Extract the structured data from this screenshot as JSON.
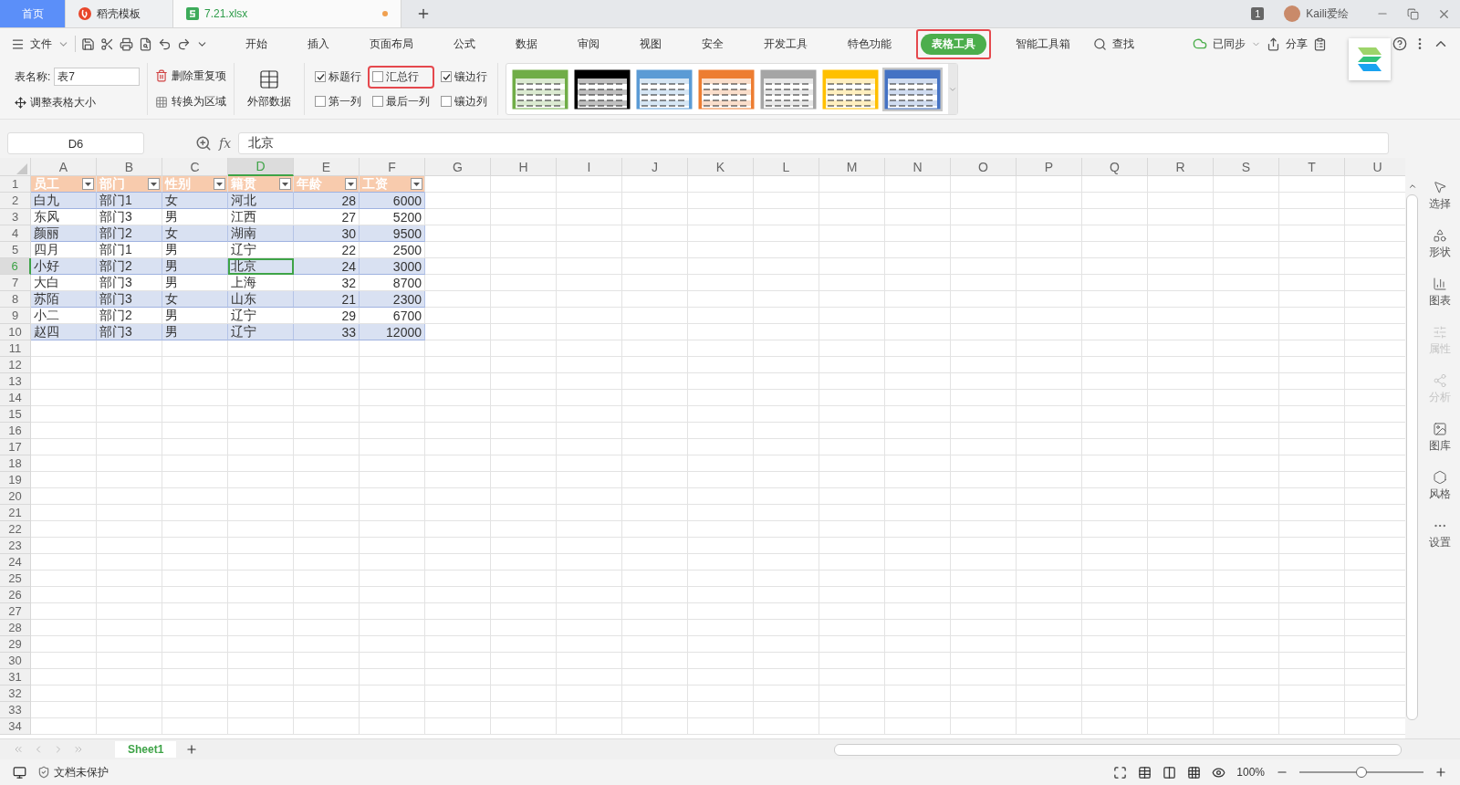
{
  "tabs": [
    {
      "kind": "home",
      "label": "首页",
      "selected": false
    },
    {
      "kind": "docer",
      "label": "稻壳模板",
      "selected": false
    },
    {
      "kind": "sheet",
      "label": "7.21.xlsx",
      "selected": true,
      "unsaved": true
    }
  ],
  "title_bar": {
    "window_count": "1",
    "user": "Kaili爱绘"
  },
  "menu": {
    "file": "文件",
    "tabs": [
      {
        "label": "开始",
        "selected": false,
        "highlighted": false
      },
      {
        "label": "插入",
        "selected": false,
        "highlighted": false
      },
      {
        "label": "页面布局",
        "selected": false,
        "highlighted": false
      },
      {
        "label": "公式",
        "selected": false,
        "highlighted": false
      },
      {
        "label": "数据",
        "selected": false,
        "highlighted": false
      },
      {
        "label": "审阅",
        "selected": false,
        "highlighted": false
      },
      {
        "label": "视图",
        "selected": false,
        "highlighted": false
      },
      {
        "label": "安全",
        "selected": false,
        "highlighted": false
      },
      {
        "label": "开发工具",
        "selected": false,
        "highlighted": false
      },
      {
        "label": "特色功能",
        "selected": false,
        "highlighted": false
      },
      {
        "label": "表格工具",
        "selected": true,
        "highlighted": true
      },
      {
        "label": "智能工具箱",
        "selected": false,
        "highlighted": false
      }
    ],
    "search": "查找",
    "sync": "已同步",
    "share": "分享"
  },
  "ribbon": {
    "table_name_label": "表名称:",
    "table_name": "表7",
    "resize": "调整表格大小",
    "remove_duplicates": "删除重复项",
    "convert_to_range": "转换为区域",
    "external_data": "外部数据",
    "options": [
      {
        "kind": "header_row",
        "label": "标题行",
        "checked": true,
        "highlighted": false
      },
      {
        "kind": "total_row",
        "label": "汇总行",
        "checked": false,
        "highlighted": true
      },
      {
        "kind": "banded_rows",
        "label": "镶边行",
        "checked": true,
        "highlighted": false
      },
      {
        "kind": "first_column",
        "label": "第一列",
        "checked": false,
        "highlighted": false
      },
      {
        "kind": "last_column",
        "label": "最后一列",
        "checked": false,
        "highlighted": false
      },
      {
        "kind": "banded_columns",
        "label": "镶边列",
        "checked": false,
        "highlighted": false
      }
    ],
    "styles": [
      {
        "color": "#70ad47",
        "selected": false
      },
      {
        "color": "#000000",
        "selected": false
      },
      {
        "color": "#5b9bd5",
        "selected": false
      },
      {
        "color": "#ed7d31",
        "selected": false
      },
      {
        "color": "#a5a5a5",
        "selected": false
      },
      {
        "color": "#ffc000",
        "selected": false
      },
      {
        "color": "#4472c4",
        "selected": true
      }
    ]
  },
  "formula_bar": {
    "cell_ref": "D6",
    "fx": "fx",
    "value": "北京"
  },
  "grid": {
    "columns": [
      {
        "label": "A",
        "selected": false
      },
      {
        "label": "B",
        "selected": false
      },
      {
        "label": "C",
        "selected": false
      },
      {
        "label": "D",
        "selected": true
      },
      {
        "label": "E",
        "selected": false
      },
      {
        "label": "F",
        "selected": false
      },
      {
        "label": "G",
        "selected": false
      },
      {
        "label": "H",
        "selected": false
      },
      {
        "label": "I",
        "selected": false
      },
      {
        "label": "J",
        "selected": false
      },
      {
        "label": "K",
        "selected": false
      },
      {
        "label": "L",
        "selected": false
      },
      {
        "label": "M",
        "selected": false
      },
      {
        "label": "N",
        "selected": false
      },
      {
        "label": "O",
        "selected": false
      },
      {
        "label": "P",
        "selected": false
      },
      {
        "label": "Q",
        "selected": false
      },
      {
        "label": "R",
        "selected": false
      },
      {
        "label": "S",
        "selected": false
      },
      {
        "label": "T",
        "selected": false
      },
      {
        "label": "U",
        "selected": false
      }
    ],
    "rows": [
      {
        "label": "1",
        "selected": false
      },
      {
        "label": "2",
        "selected": false
      },
      {
        "label": "3",
        "selected": false
      },
      {
        "label": "4",
        "selected": false
      },
      {
        "label": "5",
        "selected": false
      },
      {
        "label": "6",
        "selected": true
      },
      {
        "label": "7",
        "selected": false
      },
      {
        "label": "8",
        "selected": false
      },
      {
        "label": "9",
        "selected": false
      },
      {
        "label": "10",
        "selected": false
      },
      {
        "label": "11",
        "selected": false
      },
      {
        "label": "12",
        "selected": false
      },
      {
        "label": "13",
        "selected": false
      },
      {
        "label": "14",
        "selected": false
      },
      {
        "label": "15",
        "selected": false
      },
      {
        "label": "16",
        "selected": false
      },
      {
        "label": "17",
        "selected": false
      },
      {
        "label": "18",
        "selected": false
      },
      {
        "label": "19",
        "selected": false
      },
      {
        "label": "20",
        "selected": false
      },
      {
        "label": "21",
        "selected": false
      },
      {
        "label": "22",
        "selected": false
      },
      {
        "label": "23",
        "selected": false
      },
      {
        "label": "24",
        "selected": false
      },
      {
        "label": "25",
        "selected": false
      },
      {
        "label": "26",
        "selected": false
      },
      {
        "label": "27",
        "selected": false
      },
      {
        "label": "28",
        "selected": false
      },
      {
        "label": "29",
        "selected": false
      },
      {
        "label": "30",
        "selected": false
      },
      {
        "label": "31",
        "selected": false
      },
      {
        "label": "32",
        "selected": false
      },
      {
        "label": "33",
        "selected": false
      },
      {
        "label": "34",
        "selected": false
      }
    ]
  },
  "table": {
    "columns": [
      {
        "label": "员工",
        "numeric": false
      },
      {
        "label": "部门",
        "numeric": false
      },
      {
        "label": "性别",
        "numeric": false
      },
      {
        "label": "籍贯",
        "numeric": false
      },
      {
        "label": "年龄",
        "numeric": true
      },
      {
        "label": "工资",
        "numeric": true
      }
    ],
    "rows": [
      [
        {
          "text": "白九",
          "selected": false
        },
        {
          "text": "部门1",
          "selected": false
        },
        {
          "text": "女",
          "selected": false
        },
        {
          "text": "河北",
          "selected": false
        },
        {
          "text": "28",
          "selected": false
        },
        {
          "text": "6000",
          "selected": false
        }
      ],
      [
        {
          "text": "东风",
          "selected": false
        },
        {
          "text": "部门3",
          "selected": false
        },
        {
          "text": "男",
          "selected": false
        },
        {
          "text": "江西",
          "selected": false
        },
        {
          "text": "27",
          "selected": false
        },
        {
          "text": "5200",
          "selected": false
        }
      ],
      [
        {
          "text": "颜丽",
          "selected": false
        },
        {
          "text": "部门2",
          "selected": false
        },
        {
          "text": "女",
          "selected": false
        },
        {
          "text": "湖南",
          "selected": false
        },
        {
          "text": "30",
          "selected": false
        },
        {
          "text": "9500",
          "selected": false
        }
      ],
      [
        {
          "text": "四月",
          "selected": false
        },
        {
          "text": "部门1",
          "selected": false
        },
        {
          "text": "男",
          "selected": false
        },
        {
          "text": "辽宁",
          "selected": false
        },
        {
          "text": "22",
          "selected": false
        },
        {
          "text": "2500",
          "selected": false
        }
      ],
      [
        {
          "text": "小好",
          "selected": false
        },
        {
          "text": "部门2",
          "selected": false
        },
        {
          "text": "男",
          "selected": false
        },
        {
          "text": "北京",
          "selected": true
        },
        {
          "text": "24",
          "selected": false
        },
        {
          "text": "3000",
          "selected": false
        }
      ],
      [
        {
          "text": "大白",
          "selected": false
        },
        {
          "text": "部门3",
          "selected": false
        },
        {
          "text": "男",
          "selected": false
        },
        {
          "text": "上海",
          "selected": false
        },
        {
          "text": "32",
          "selected": false
        },
        {
          "text": "8700",
          "selected": false
        }
      ],
      [
        {
          "text": "苏陌",
          "selected": false
        },
        {
          "text": "部门3",
          "selected": false
        },
        {
          "text": "女",
          "selected": false
        },
        {
          "text": "山东",
          "selected": false
        },
        {
          "text": "21",
          "selected": false
        },
        {
          "text": "2300",
          "selected": false
        }
      ],
      [
        {
          "text": "小二",
          "selected": false
        },
        {
          "text": "部门2",
          "selected": false
        },
        {
          "text": "男",
          "selected": false
        },
        {
          "text": "辽宁",
          "selected": false
        },
        {
          "text": "29",
          "selected": false
        },
        {
          "text": "6700",
          "selected": false
        }
      ],
      [
        {
          "text": "赵四",
          "selected": false
        },
        {
          "text": "部门3",
          "selected": false
        },
        {
          "text": "男",
          "selected": false
        },
        {
          "text": "辽宁",
          "selected": false
        },
        {
          "text": "33",
          "selected": false
        },
        {
          "text": "12000",
          "selected": false
        }
      ]
    ]
  },
  "sidebar": [
    {
      "kind": "select",
      "label": "选择",
      "disabled": false
    },
    {
      "kind": "shape",
      "label": "形状",
      "disabled": false
    },
    {
      "kind": "chart",
      "label": "图表",
      "disabled": false
    },
    {
      "kind": "property",
      "label": "属性",
      "disabled": true
    },
    {
      "kind": "analysis",
      "label": "分析",
      "disabled": true
    },
    {
      "kind": "gallery",
      "label": "图库",
      "disabled": false
    },
    {
      "kind": "style",
      "label": "风格",
      "disabled": false
    },
    {
      "kind": "settings",
      "label": "设置",
      "disabled": false
    }
  ],
  "sheets": [
    {
      "label": "Sheet1",
      "selected": true
    }
  ],
  "status_bar": {
    "protection": "文档未保护",
    "zoom": "100%",
    "zoom_level": {
      "level": 0.5
    }
  }
}
